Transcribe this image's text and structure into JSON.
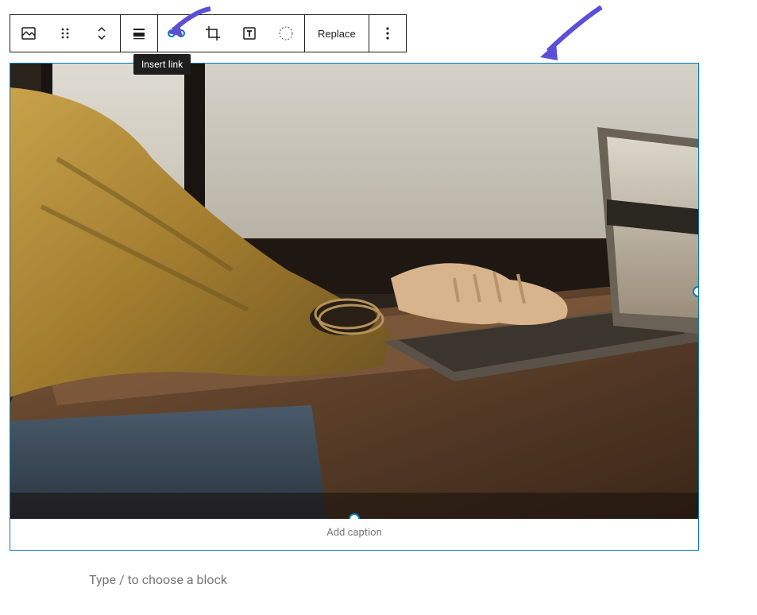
{
  "toolbar": {
    "block_icon": "image-icon",
    "drag_icon": "drag-handle-icon",
    "move_icon": "move-up-down-icon",
    "align_icon": "align-icon",
    "link_icon": "link-icon",
    "crop_icon": "crop-icon",
    "text_overlay_icon": "text-overlay-icon",
    "duotone_icon": "duotone-icon",
    "replace_label": "Replace",
    "more_icon": "more-options-icon"
  },
  "tooltip": {
    "text": "Insert link"
  },
  "background_text_fragment": "r.",
  "image_block": {
    "caption_placeholder": "Add caption",
    "alt_description": "Person in mustard sweater typing on a laptop at a wooden desk near a window"
  },
  "block_prompt": {
    "placeholder": "Type / to choose a block"
  },
  "colors": {
    "accent": "#007cba",
    "annotation": "#5b4fd8"
  }
}
